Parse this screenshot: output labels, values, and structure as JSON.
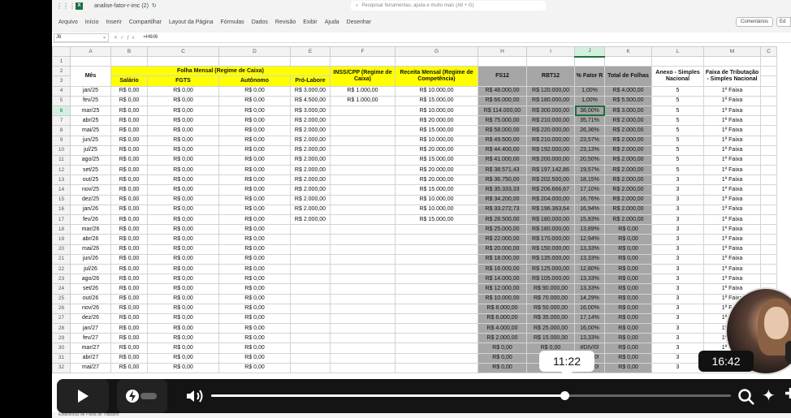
{
  "titlebar": {
    "filename": "analise-fator-r-imc (2)",
    "search_placeholder": "Pesquisar ferramentas, ajuda e muito mais (Alt + G)"
  },
  "menu": [
    "Arquivo",
    "Início",
    "Inserir",
    "Compartilhar",
    "Layout da Página",
    "Fórmulas",
    "Dados",
    "Revisão",
    "Exibir",
    "Ajuda",
    "Desenhar"
  ],
  "comments_label": "Comentários",
  "share_label": "Ed",
  "namebox": "J6",
  "formula": "=H6/I6",
  "columns": [
    "A",
    "B",
    "C",
    "D",
    "E",
    "F",
    "G",
    "H",
    "I",
    "J",
    "K",
    "L",
    "M",
    "C"
  ],
  "headers": {
    "mes": "Mês",
    "folha": "Folha Mensal (Regime de Caixa)",
    "salario": "Salário",
    "fgts": "FGTS",
    "autonomo": "Autônomo",
    "prolabore": "Pró-Labore",
    "inss": "INSS/CPP (Regime de Caixa)",
    "receita": "Receita Mensal (Regime de Competência)",
    "fs12": "FS12",
    "rbt12": "RBT12",
    "fator": "% Fator R",
    "total": "Total de Folhas",
    "anexo": "Anexo - Simples Nacional",
    "faixa": "Faixa de Tributação - Simples Nacional"
  },
  "rows": [
    [
      "jan/25",
      "R$ 0,00",
      "R$ 0,00",
      "R$ 0,00",
      "R$ 3.000,00",
      "R$ 1.000,00",
      "R$ 10.000,00",
      "R$ 48.000,00",
      "R$ 120.000,00",
      "1,00%",
      "R$ 4.000,00",
      "5",
      "1ª Faixa"
    ],
    [
      "fev/25",
      "R$ 0,00",
      "R$ 0,00",
      "R$ 0,00",
      "R$ 4.500,00",
      "R$ 1.000,00",
      "R$ 15.000,00",
      "R$ 66.000,00",
      "R$ 180.000,00",
      "1,00%",
      "R$ 5.500,00",
      "5",
      "1ª Faixa"
    ],
    [
      "mar/25",
      "R$ 0,00",
      "R$ 0,00",
      "R$ 0,00",
      "R$ 3.000,00",
      "",
      "R$ 10.000,00",
      "R$ 114.000,00",
      "R$ 300.000,00",
      "38,00%",
      "R$ 3.000,00",
      "5",
      "1ª Faixa"
    ],
    [
      "abr/25",
      "R$ 0,00",
      "R$ 0,00",
      "R$ 0,00",
      "R$ 2.000,00",
      "",
      "R$ 20.000,00",
      "R$ 75.000,00",
      "R$ 210.000,00",
      "35,71%",
      "R$ 2.000,00",
      "5",
      "1ª Faixa"
    ],
    [
      "mai/25",
      "R$ 0,00",
      "R$ 0,00",
      "R$ 0,00",
      "R$ 2.000,00",
      "",
      "R$ 15.000,00",
      "R$ 58.000,00",
      "R$ 220.000,00",
      "26,36%",
      "R$ 2.000,00",
      "5",
      "1ª Faixa"
    ],
    [
      "jun/25",
      "R$ 0,00",
      "R$ 0,00",
      "R$ 0,00",
      "R$ 2.000,00",
      "",
      "R$ 10.000,00",
      "R$ 49.500,00",
      "R$ 210.000,00",
      "23,57%",
      "R$ 2.000,00",
      "5",
      "1ª Faixa"
    ],
    [
      "jul/25",
      "R$ 0,00",
      "R$ 0,00",
      "R$ 0,00",
      "R$ 2.000,00",
      "",
      "R$ 20.000,00",
      "R$ 44.400,00",
      "R$ 192.000,00",
      "23,13%",
      "R$ 2.000,00",
      "5",
      "1ª Faixa"
    ],
    [
      "ago/25",
      "R$ 0,00",
      "R$ 0,00",
      "R$ 0,00",
      "R$ 2.000,00",
      "",
      "R$ 15.000,00",
      "R$ 41.000,00",
      "R$ 200.000,00",
      "20,50%",
      "R$ 2.000,00",
      "5",
      "1ª Faixa"
    ],
    [
      "set/25",
      "R$ 0,00",
      "R$ 0,00",
      "R$ 0,00",
      "R$ 2.000,00",
      "",
      "R$ 20.000,00",
      "R$ 38.571,43",
      "R$ 197.142,86",
      "19,57%",
      "R$ 2.000,00",
      "5",
      "1ª Faixa"
    ],
    [
      "out/25",
      "R$ 0,00",
      "R$ 0,00",
      "R$ 0,00",
      "R$ 2.000,00",
      "",
      "R$ 20.000,00",
      "R$ 36.750,00",
      "R$ 202.500,00",
      "18,15%",
      "R$ 2.000,00",
      "3",
      "1ª Faixa"
    ],
    [
      "nov/25",
      "R$ 0,00",
      "R$ 0,00",
      "R$ 0,00",
      "R$ 2.000,00",
      "",
      "R$ 15.000,00",
      "R$ 35.333,33",
      "R$ 206.666,67",
      "17,10%",
      "R$ 2.000,00",
      "3",
      "1ª Faixa"
    ],
    [
      "dez/25",
      "R$ 0,00",
      "R$ 0,00",
      "R$ 0,00",
      "R$ 2.000,00",
      "",
      "R$ 10.000,00",
      "R$ 34.200,00",
      "R$ 204.000,00",
      "16,76%",
      "R$ 2.000,00",
      "3",
      "1ª Faixa"
    ],
    [
      "jan/26",
      "R$ 0,00",
      "R$ 0,00",
      "R$ 0,00",
      "R$ 2.000,00",
      "",
      "R$ 10.000,00",
      "R$ 33.272,73",
      "R$ 196.363,64",
      "16,94%",
      "R$ 2.000,00",
      "3",
      "1ª Faixa"
    ],
    [
      "fev/26",
      "R$ 0,00",
      "R$ 0,00",
      "R$ 0,00",
      "R$ 2.000,00",
      "",
      "R$ 15.000,00",
      "R$ 28.500,00",
      "R$ 180.000,00",
      "15,83%",
      "R$ 2.000,00",
      "3",
      "1ª Faixa"
    ],
    [
      "mar/26",
      "R$ 0,00",
      "R$ 0,00",
      "R$ 0,00",
      "",
      "",
      "",
      "R$ 25.000,00",
      "R$ 180.000,00",
      "13,89%",
      "R$ 0,00",
      "3",
      "1ª Faixa"
    ],
    [
      "abr/26",
      "R$ 0,00",
      "R$ 0,00",
      "R$ 0,00",
      "",
      "",
      "",
      "R$ 22.000,00",
      "R$ 170.000,00",
      "12,94%",
      "R$ 0,00",
      "3",
      "1ª Faixa"
    ],
    [
      "mai/26",
      "R$ 0,00",
      "R$ 0,00",
      "R$ 0,00",
      "",
      "",
      "",
      "R$ 20.000,00",
      "R$ 150.000,00",
      "13,33%",
      "R$ 0,00",
      "3",
      "1ª Faixa"
    ],
    [
      "jun/26",
      "R$ 0,00",
      "R$ 0,00",
      "R$ 0,00",
      "",
      "",
      "",
      "R$ 18.000,00",
      "R$ 135.000,00",
      "13,33%",
      "R$ 0,00",
      "3",
      "1ª Faixa"
    ],
    [
      "jul/26",
      "R$ 0,00",
      "R$ 0,00",
      "R$ 0,00",
      "",
      "",
      "",
      "R$ 16.000,00",
      "R$ 125.000,00",
      "12,80%",
      "R$ 0,00",
      "3",
      "1ª Faixa"
    ],
    [
      "ago/26",
      "R$ 0,00",
      "R$ 0,00",
      "R$ 0,00",
      "",
      "",
      "",
      "R$ 14.000,00",
      "R$ 105.000,00",
      "13,33%",
      "R$ 0,00",
      "3",
      "1ª Faixa"
    ],
    [
      "set/26",
      "R$ 0,00",
      "R$ 0,00",
      "R$ 0,00",
      "",
      "",
      "",
      "R$ 12.000,00",
      "R$ 90.000,00",
      "13,33%",
      "R$ 0,00",
      "3",
      "1ª Faixa"
    ],
    [
      "out/26",
      "R$ 0,00",
      "R$ 0,00",
      "R$ 0,00",
      "",
      "",
      "",
      "R$ 10.000,00",
      "R$ 70.000,00",
      "14,29%",
      "R$ 0,00",
      "3",
      "1ª Faixa"
    ],
    [
      "nov/26",
      "R$ 0,00",
      "R$ 0,00",
      "R$ 0,00",
      "",
      "",
      "",
      "R$ 8.000,00",
      "R$ 50.000,00",
      "16,00%",
      "R$ 0,00",
      "3",
      "1ª Faixa"
    ],
    [
      "dez/26",
      "R$ 0,00",
      "R$ 0,00",
      "R$ 0,00",
      "",
      "",
      "",
      "R$ 6.000,00",
      "R$ 35.000,00",
      "17,14%",
      "R$ 0,00",
      "3",
      "1ª Faixa"
    ],
    [
      "jan/27",
      "R$ 0,00",
      "R$ 0,00",
      "R$ 0,00",
      "",
      "",
      "",
      "R$ 4.000,00",
      "R$ 25.000,00",
      "16,00%",
      "R$ 0,00",
      "3",
      "1ª Faixa"
    ],
    [
      "fev/27",
      "R$ 0,00",
      "R$ 0,00",
      "R$ 0,00",
      "",
      "",
      "",
      "R$ 2.000,00",
      "R$ 15.000,00",
      "13,33%",
      "R$ 0,00",
      "3",
      "1ª Faixa"
    ],
    [
      "mar/27",
      "R$ 0,00",
      "R$ 0,00",
      "R$ 0,00",
      "",
      "",
      "",
      "R$ 0,00",
      "R$ 0,00",
      "#DIV/0!",
      "R$ 0,00",
      "3",
      "1ª Faixa"
    ],
    [
      "abr/27",
      "R$ 0,00",
      "R$ 0,00",
      "R$ 0,00",
      "",
      "",
      "",
      "R$ 0,00",
      "R$ 0,00",
      "#DIV/0!",
      "R$ 0,00",
      "3",
      "1ª Faixa"
    ],
    [
      "mai/27",
      "R$ 0,00",
      "R$ 0,00",
      "R$ 0,00",
      "",
      "",
      "",
      "R$ 0,00",
      "R$ 0,00",
      "#DIV/0!",
      "R$ 0,00",
      "3",
      "1ª Faixa"
    ]
  ],
  "player": {
    "progress": 0.68,
    "hover_time": "11:22",
    "total_time": "16:42"
  },
  "statusbar": "Estatísticas de Pasta de Trabalho",
  "colors": {
    "yellow": "#ffff00",
    "gray": "#a6a6a6",
    "excel_green": "#1d6f42"
  }
}
